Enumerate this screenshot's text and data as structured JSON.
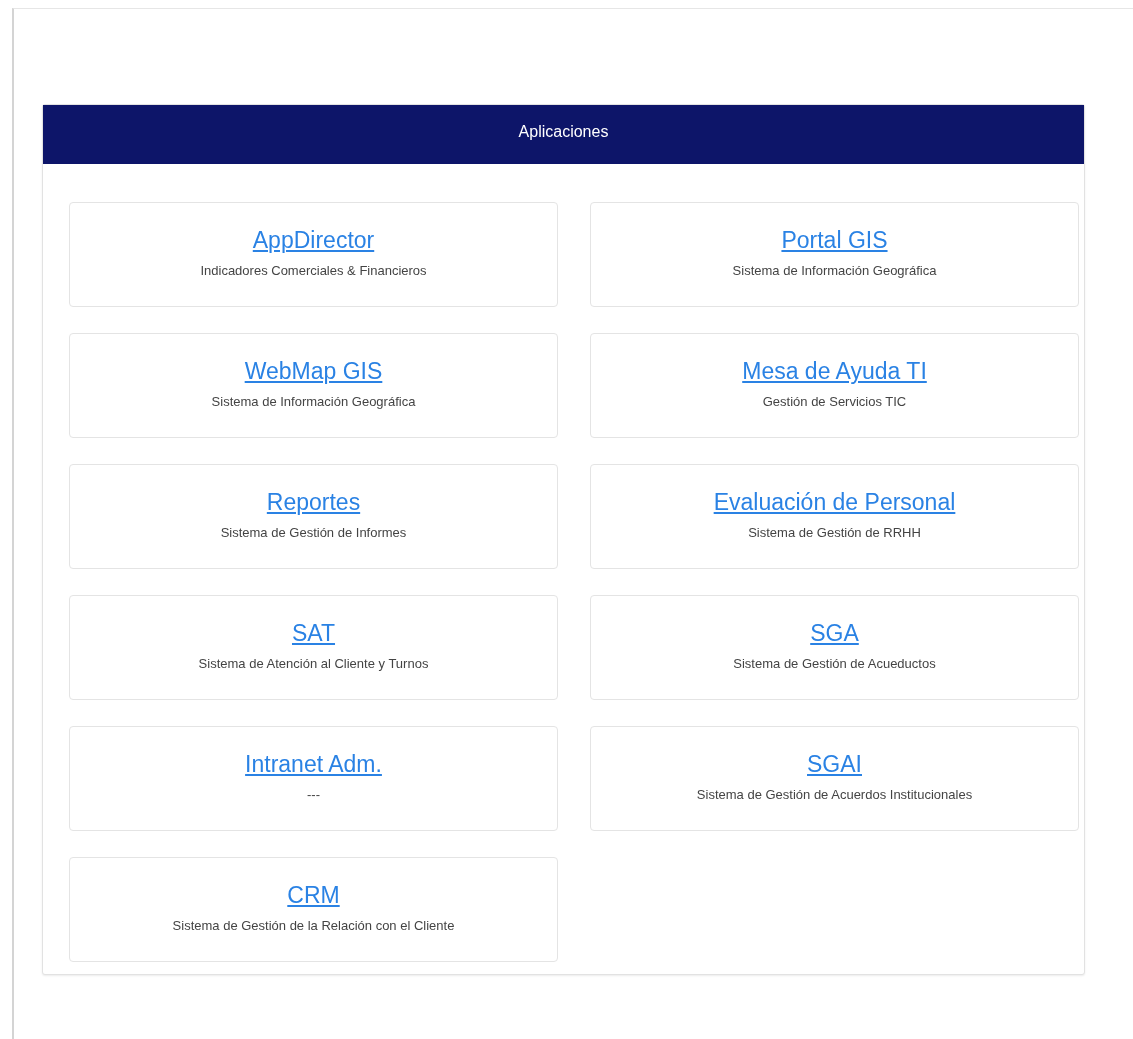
{
  "panel": {
    "title": "Aplicaciones"
  },
  "apps": [
    {
      "name": "AppDirector",
      "description": "Indicadores Comerciales & Financieros"
    },
    {
      "name": "Portal GIS",
      "description": "Sistema de Información Geográfica"
    },
    {
      "name": "WebMap GIS",
      "description": "Sistema de Información Geográfica"
    },
    {
      "name": "Mesa de Ayuda TI",
      "description": "Gestión de Servicios TIC"
    },
    {
      "name": "Reportes",
      "description": "Sistema de Gestión de Informes"
    },
    {
      "name": "Evaluación de Personal",
      "description": "Sistema de Gestión de RRHH"
    },
    {
      "name": "SAT",
      "description": "Sistema de Atención al Cliente y Turnos"
    },
    {
      "name": "SGA",
      "description": "Sistema de Gestión de Acueductos"
    },
    {
      "name": "Intranet Adm.",
      "description": "---"
    },
    {
      "name": "SGAI",
      "description": "Sistema de Gestión de Acuerdos Institucionales"
    },
    {
      "name": "CRM",
      "description": "Sistema de Gestión de la Relación con el Cliente"
    }
  ]
}
